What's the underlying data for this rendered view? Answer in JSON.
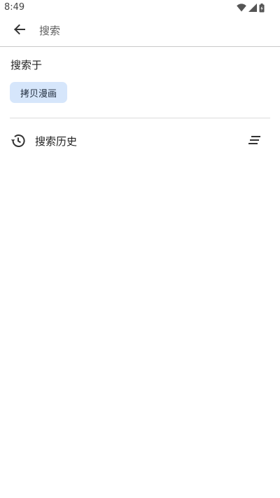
{
  "status_bar": {
    "time": "8:49",
    "icons": [
      "wifi-icon",
      "cellular-signal-icon",
      "battery-charging-icon"
    ]
  },
  "app_bar": {
    "back_icon": "arrow-back-icon",
    "search_placeholder": "搜索",
    "search_value": ""
  },
  "search_in": {
    "title": "搜索于",
    "chips": [
      {
        "label": "拷贝漫画",
        "selected": true
      }
    ]
  },
  "history": {
    "icon": "history-icon",
    "label": "搜索历史",
    "clear_icon": "clear-all-icon"
  },
  "colors": {
    "chip_background": "#d6e6fb",
    "text_primary": "#222222",
    "divider": "#dcdcdc"
  }
}
